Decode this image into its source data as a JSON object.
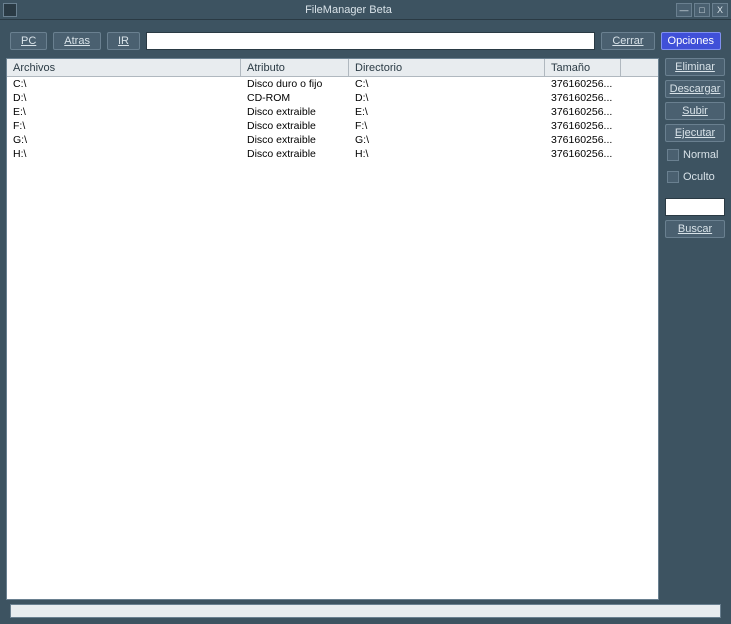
{
  "window": {
    "title": "FileManager Beta"
  },
  "toolbar": {
    "pc": "PC",
    "atras": "Atras",
    "ir": "IR",
    "cerrar": "Cerrar",
    "opciones": "Opciones",
    "path": ""
  },
  "columns": {
    "archivos": "Archivos",
    "atributo": "Atributo",
    "directorio": "Directorio",
    "tamano": "Tamaño"
  },
  "rows": [
    {
      "archivos": "C:\\",
      "atributo": "Disco duro o fijo",
      "directorio": "C:\\",
      "tamano": "376160256..."
    },
    {
      "archivos": "D:\\",
      "atributo": "CD-ROM",
      "directorio": "D:\\",
      "tamano": "376160256..."
    },
    {
      "archivos": "E:\\",
      "atributo": "Disco extraible",
      "directorio": "E:\\",
      "tamano": "376160256..."
    },
    {
      "archivos": "F:\\",
      "atributo": "Disco extraible",
      "directorio": "F:\\",
      "tamano": "376160256..."
    },
    {
      "archivos": "G:\\",
      "atributo": "Disco extraible",
      "directorio": "G:\\",
      "tamano": "376160256..."
    },
    {
      "archivos": "H:\\",
      "atributo": "Disco extraible",
      "directorio": "H:\\",
      "tamano": "376160256..."
    }
  ],
  "sidebar": {
    "eliminar": "Eliminar",
    "descargar": "Descargar",
    "subir": "Subir",
    "ejecutar": "Ejecutar",
    "normal": "Normal",
    "oculto": "Oculto",
    "buscar": "Buscar",
    "search_value": ""
  }
}
